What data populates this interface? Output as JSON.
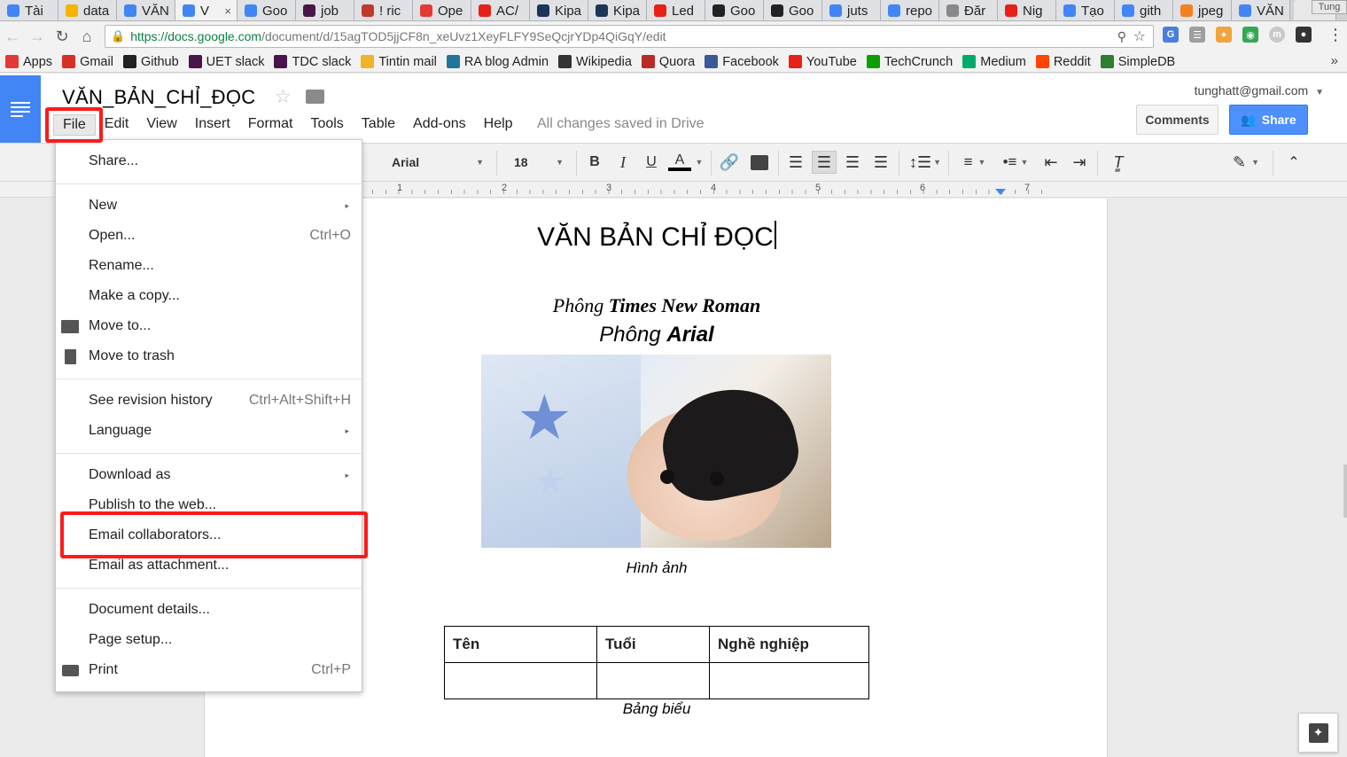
{
  "browser": {
    "tabs": [
      {
        "label": "Tài",
        "icon": "google-icon",
        "color": "#4285f4"
      },
      {
        "label": "data",
        "icon": "drive-icon",
        "color": "#f4b400"
      },
      {
        "label": "VĂN",
        "icon": "docs-icon",
        "color": "#4285f4"
      },
      {
        "label": "V",
        "icon": "docs-icon",
        "color": "#4285f4",
        "active": true
      },
      {
        "label": "Goo",
        "icon": "docs-icon",
        "color": "#4285f4"
      },
      {
        "label": "job",
        "icon": "slack-icon",
        "color": "#4a154b"
      },
      {
        "label": "! ric",
        "icon": "bookmark-icon",
        "color": "#c0392b"
      },
      {
        "label": "Ope",
        "icon": "pokeball-icon",
        "color": "#e53935"
      },
      {
        "label": "AC/",
        "icon": "youtube-icon",
        "color": "#e62117"
      },
      {
        "label": "Kipa",
        "icon": "kipalog-icon",
        "color": "#1d3557"
      },
      {
        "label": "Kipa",
        "icon": "kipalog-icon",
        "color": "#1d3557"
      },
      {
        "label": "Led",
        "icon": "youtube-icon",
        "color": "#e62117"
      },
      {
        "label": "Goo",
        "icon": "github-icon",
        "color": "#222222"
      },
      {
        "label": "Goo",
        "icon": "github-icon",
        "color": "#222222"
      },
      {
        "label": "juts",
        "icon": "google-icon",
        "color": "#4285f4"
      },
      {
        "label": "repo",
        "icon": "google-icon",
        "color": "#4285f4"
      },
      {
        "label": "Đăr",
        "icon": "page-icon",
        "color": "#888888"
      },
      {
        "label": "Nig",
        "icon": "youtube-icon",
        "color": "#e62117"
      },
      {
        "label": "Tạo",
        "icon": "google-icon",
        "color": "#4285f4"
      },
      {
        "label": "gith",
        "icon": "google-icon",
        "color": "#4285f4"
      },
      {
        "label": "jpeg",
        "icon": "stackoverflow-icon",
        "color": "#f48024"
      },
      {
        "label": "VĂN",
        "icon": "docs-icon",
        "color": "#4285f4"
      }
    ],
    "user_label": "Tung",
    "url_host": "https://docs.google.com",
    "url_path": "/document/d/15agTOD5jjCF8n_xeUvz1XeyFLFY9SeQcjrYDp4QiGqY/edit",
    "bookmarks": [
      {
        "label": "Apps",
        "icon": "apps-grid-icon",
        "color": "#e53935"
      },
      {
        "label": "Gmail",
        "icon": "gmail-icon",
        "color": "#d93025"
      },
      {
        "label": "Github",
        "icon": "github-icon",
        "color": "#222222"
      },
      {
        "label": "UET slack",
        "icon": "slack-icon",
        "color": "#4a154b"
      },
      {
        "label": "TDC slack",
        "icon": "slack-icon",
        "color": "#4a154b"
      },
      {
        "label": "Tintin mail",
        "icon": "mail-icon",
        "color": "#f0b429"
      },
      {
        "label": "RA blog Admin",
        "icon": "wordpress-icon",
        "color": "#21759b"
      },
      {
        "label": "Wikipedia",
        "icon": "wikipedia-icon",
        "color": "#333333"
      },
      {
        "label": "Quora",
        "icon": "quora-icon",
        "color": "#b92b27"
      },
      {
        "label": "Facebook",
        "icon": "facebook-icon",
        "color": "#3b5998"
      },
      {
        "label": "YouTube",
        "icon": "youtube-icon",
        "color": "#e62117"
      },
      {
        "label": "TechCrunch",
        "icon": "techcrunch-icon",
        "color": "#0a9e01"
      },
      {
        "label": "Medium",
        "icon": "medium-icon",
        "color": "#00ab6c"
      },
      {
        "label": "Reddit",
        "icon": "reddit-icon",
        "color": "#ff4500"
      },
      {
        "label": "SimpleDB",
        "icon": "simpledb-icon",
        "color": "#2e7d32"
      }
    ],
    "bookmarks_more": "»"
  },
  "docs": {
    "title": "VĂN_BẢN_CHỈ_ĐỌC",
    "menus": [
      "File",
      "Edit",
      "View",
      "Insert",
      "Format",
      "Tools",
      "Table",
      "Add-ons",
      "Help"
    ],
    "save_status": "All changes saved in Drive",
    "account": "tunghatt@gmail.com",
    "comments_label": "Comments",
    "share_label": "Share",
    "accent": "#4285f4"
  },
  "toolbar": {
    "font": "Arial",
    "font_size": "18",
    "bold": "B",
    "italic": "I",
    "underline": "U",
    "text_color": "A"
  },
  "ruler": {
    "numbers": [
      "1",
      "2",
      "3",
      "4",
      "5",
      "6",
      "7"
    ]
  },
  "document": {
    "heading": "VĂN BẢN CHỈ ĐỌC",
    "tnr_prefix": "Phông ",
    "tnr_bold": "Times New Roman",
    "arial_prefix": "Phông ",
    "arial_bold": "Arial",
    "image_caption": "Hình ảnh",
    "table": {
      "headers": [
        "Tên",
        "Tuổi",
        "Nghề nghiệp"
      ],
      "rows": [
        [
          "",
          "",
          ""
        ]
      ]
    },
    "table_caption": "Bảng biểu"
  },
  "file_menu": {
    "items": [
      {
        "label": "Share...",
        "shortcut": "",
        "submenu": false,
        "icon": ""
      },
      {
        "label": "New",
        "shortcut": "",
        "submenu": true,
        "icon": ""
      },
      {
        "label": "Open...",
        "shortcut": "Ctrl+O",
        "submenu": false,
        "icon": ""
      },
      {
        "label": "Rename...",
        "shortcut": "",
        "submenu": false,
        "icon": ""
      },
      {
        "label": "Make a copy...",
        "shortcut": "",
        "submenu": false,
        "icon": ""
      },
      {
        "label": "Move to...",
        "shortcut": "",
        "submenu": false,
        "icon": "folder-icon"
      },
      {
        "label": "Move to trash",
        "shortcut": "",
        "submenu": false,
        "icon": "trash-icon"
      },
      {
        "label": "See revision history",
        "shortcut": "Ctrl+Alt+Shift+H",
        "submenu": false,
        "icon": ""
      },
      {
        "label": "Language",
        "shortcut": "",
        "submenu": true,
        "icon": ""
      },
      {
        "label": "Download as",
        "shortcut": "",
        "submenu": true,
        "icon": ""
      },
      {
        "label": "Publish to the web...",
        "shortcut": "",
        "submenu": false,
        "icon": ""
      },
      {
        "label": "Email collaborators...",
        "shortcut": "",
        "submenu": false,
        "icon": ""
      },
      {
        "label": "Email as attachment...",
        "shortcut": "",
        "submenu": false,
        "icon": ""
      },
      {
        "label": "Document details...",
        "shortcut": "",
        "submenu": false,
        "icon": ""
      },
      {
        "label": "Page setup...",
        "shortcut": "",
        "submenu": false,
        "icon": ""
      },
      {
        "label": "Print",
        "shortcut": "Ctrl+P",
        "submenu": false,
        "icon": "printer-icon"
      }
    ]
  },
  "highlight_color": "#ff1a1a"
}
